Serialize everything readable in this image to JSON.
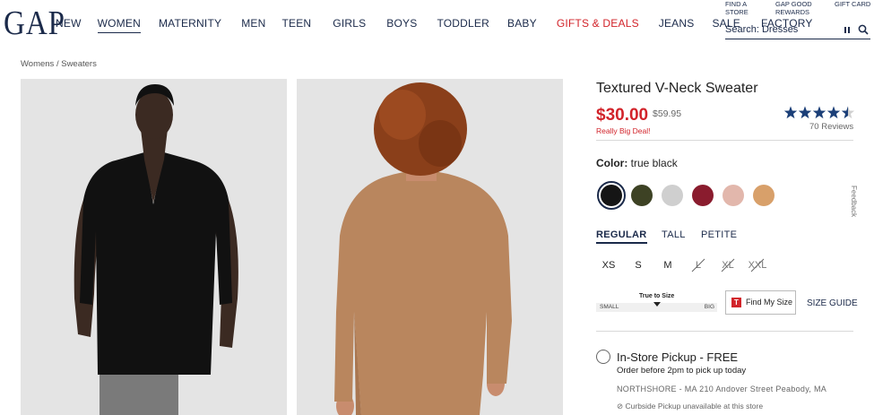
{
  "header": {
    "logo": "GAP",
    "nav": [
      "NEW",
      "WOMEN",
      "MATERNITY",
      "MEN",
      "TEEN",
      "GIRLS",
      "BOYS",
      "TODDLER",
      "BABY",
      "GIFTS & DEALS",
      "JEANS",
      "SALE",
      "FACTORY"
    ],
    "active_nav": "WOMEN",
    "utility": {
      "find_store": [
        "FIND A",
        "STORE"
      ],
      "gap_good": [
        "GAP GOOD",
        "REWARDS"
      ],
      "gift_card": "GIFT CARD"
    },
    "search_text": "Search: Dresses",
    "icons": [
      "pause-icon",
      "search-icon"
    ]
  },
  "breadcrumb": {
    "level1": "Womens",
    "separator": "/",
    "level2": "Sweaters"
  },
  "product": {
    "title": "Textured V-Neck Sweater",
    "price": "$30.00",
    "original_price": "$59.95",
    "deal_label": "Really Big Deal!",
    "rating": 4.5,
    "reviews": "70 Reviews",
    "color_label": "Color:",
    "color_value": "true black",
    "swatches": [
      "#151515",
      "#3d4224",
      "#cfcfcf",
      "#8a1c2e",
      "#e2b7ac",
      "#d8a06a"
    ],
    "fits": [
      "REGULAR",
      "TALL",
      "PETITE"
    ],
    "active_fit": "REGULAR",
    "sizes": [
      "XS",
      "S",
      "M",
      "L",
      "XL",
      "XXL"
    ],
    "unavailable_sizes": [
      "L",
      "XL",
      "XXL"
    ],
    "true_to_size": {
      "title": "True to Size",
      "small": "SMALL",
      "big": "BIG"
    },
    "find_my_size": "Find My Size",
    "size_guide": "SIZE GUIDE",
    "pickup": {
      "title": "In-Store Pickup - FREE",
      "subtitle": "Order before 2pm to pick up today",
      "store": "NORTHSHORE - MA 210 Andover Street  Peabody, MA",
      "curbside": "Curbside Pickup unavailable at this store"
    }
  },
  "feedback": "Feedback",
  "colors": {
    "brand_navy": "#1b2a4a",
    "sale_red": "#d2232a",
    "star_blue": "#1b3f78"
  }
}
